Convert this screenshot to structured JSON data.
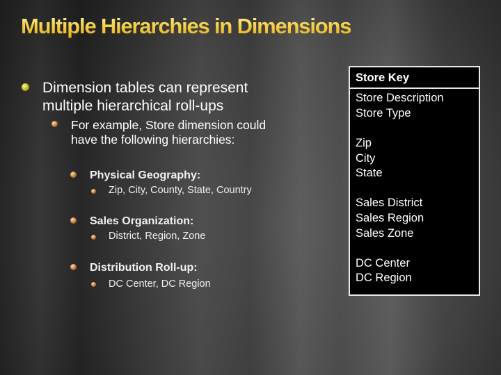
{
  "slide": {
    "title": "Multiple Hierarchies in Dimensions",
    "bullets": {
      "level1": [
        "Dimension tables can represent",
        "multiple hierarchical roll-ups"
      ],
      "level2": [
        "For example, Store dimension could",
        "have the following hierarchies:"
      ],
      "hierarchies": [
        {
          "name": "Physical Geography:",
          "levels": "Zip, City, County, State, Country"
        },
        {
          "name": "Sales Organization:",
          "levels": "District, Region, Zone"
        },
        {
          "name": "Distribution Roll-up:",
          "levels": "DC Center, DC Region"
        }
      ]
    },
    "store_table": {
      "key": "Store Key",
      "attributes": [
        "Store Description",
        "Store Type",
        "Zip",
        "City",
        "State",
        "Sales District",
        "Sales Region",
        "Sales Zone",
        "DC Center",
        "DC Region"
      ]
    },
    "colors": {
      "title_gold": "#f7d34a",
      "text": "#ffffff",
      "box_bg": "#000000",
      "box_border": "#e8e8e8"
    }
  }
}
